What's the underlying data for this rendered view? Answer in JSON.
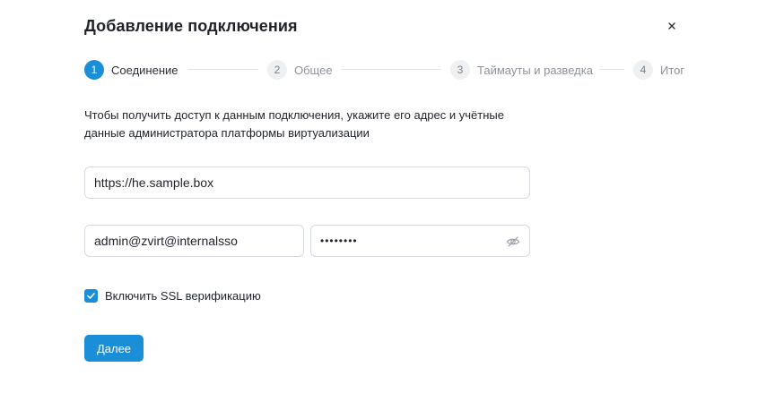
{
  "dialog": {
    "title": "Добавление подключения",
    "close_icon": "close-icon"
  },
  "stepper": {
    "steps": [
      {
        "number": "1",
        "label": "Соединение",
        "active": true
      },
      {
        "number": "2",
        "label": "Общее",
        "active": false
      },
      {
        "number": "3",
        "label": "Таймауты и разведка",
        "active": false
      },
      {
        "number": "4",
        "label": "Итог",
        "active": false
      }
    ]
  },
  "form": {
    "description": "Чтобы получить доступ к данным подключения, укажите его адрес и учётные данные администратора платформы виртуализации",
    "url_value": "https://he.sample.box",
    "username_value": "admin@zvirt@internalsso",
    "password_masked": "••••••••",
    "password_toggle_icon": "eye-off-icon",
    "ssl_checkbox": {
      "label": "Включить SSL верификацию",
      "checked": true
    },
    "next_button": "Далее"
  },
  "colors": {
    "accent": "#1a8fd8",
    "step_inactive_bg": "#eef0f2",
    "border": "#d6dade"
  }
}
